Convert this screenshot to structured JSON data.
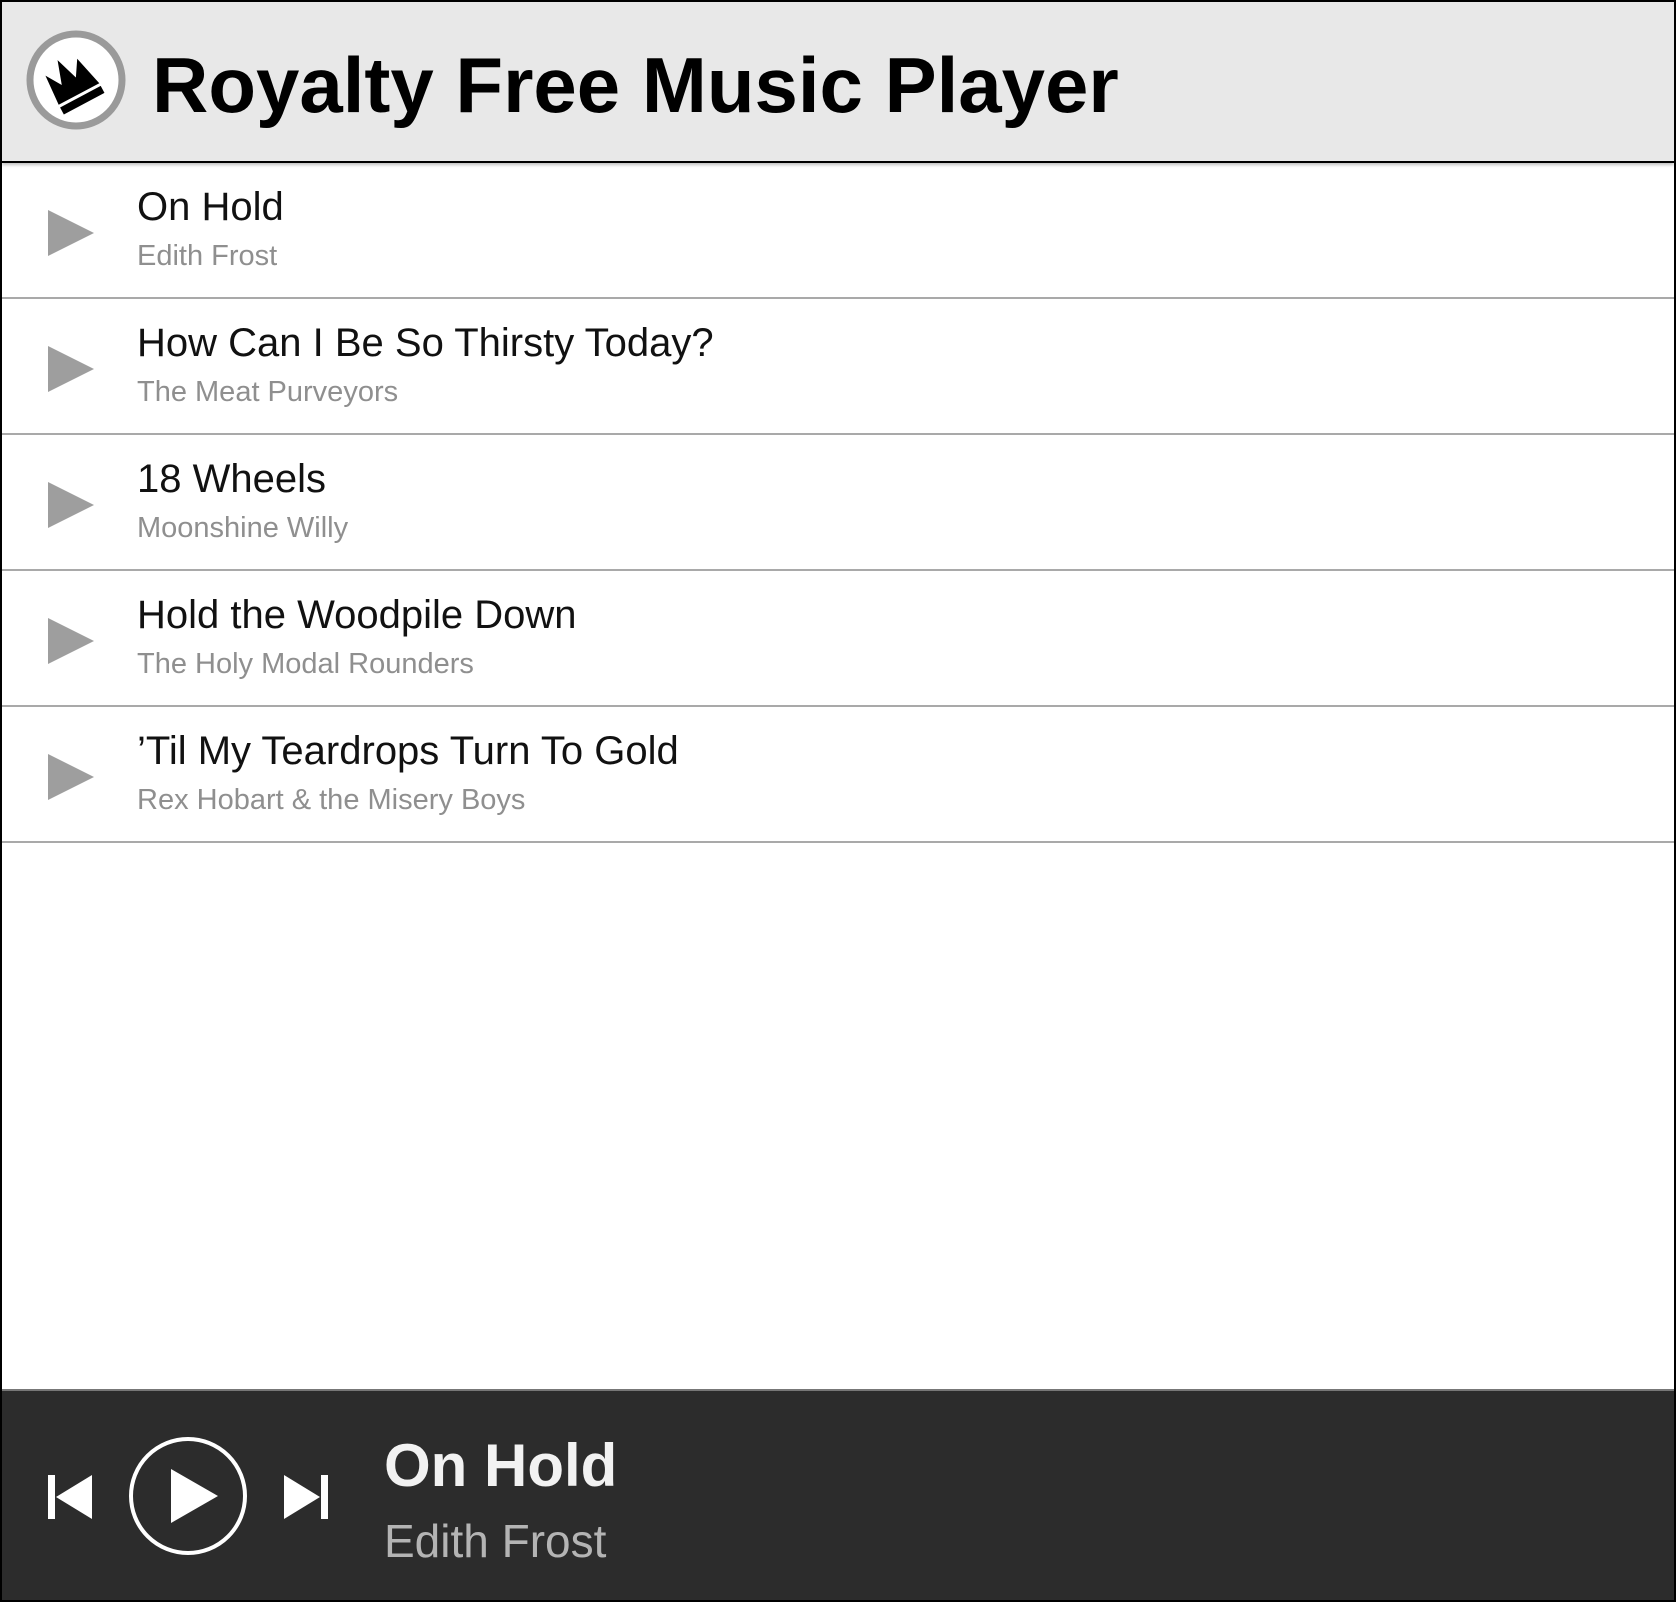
{
  "header": {
    "title": "Royalty Free Music Player",
    "logo_icon": "crown-icon"
  },
  "tracks": [
    {
      "title": "On Hold",
      "artist": "Edith Frost"
    },
    {
      "title": "How Can I Be So Thirsty Today?",
      "artist": "The Meat Purveyors"
    },
    {
      "title": "18 Wheels",
      "artist": "Moonshine Willy"
    },
    {
      "title": "Hold the Woodpile Down",
      "artist": "The Holy Modal Rounders"
    },
    {
      "title": "’Til My Teardrops Turn To Gold",
      "artist": "Rex Hobart & the Misery Boys"
    }
  ],
  "player": {
    "now_playing_title": "On Hold",
    "now_playing_artist": "Edith Frost",
    "controls": [
      "skip-previous-icon",
      "play-icon",
      "skip-next-icon"
    ]
  },
  "colors": {
    "header_bg": "#e8e8e8",
    "player_bg": "#2c2c2c",
    "track_icon": "#9e9e9e",
    "artist_text": "#8f8f8f"
  }
}
